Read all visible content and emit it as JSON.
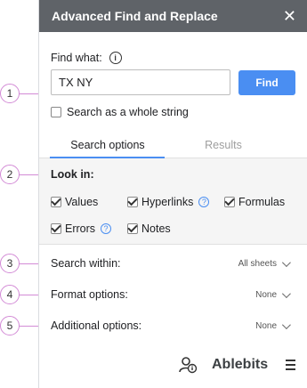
{
  "callouts": [
    "1",
    "2",
    "3",
    "4",
    "5"
  ],
  "window": {
    "title": "Advanced Find and Replace"
  },
  "find": {
    "label": "Find what:",
    "value": "TX NY",
    "button": "Find",
    "whole_string_label": "Search as a whole string",
    "whole_string_checked": false
  },
  "tabs": [
    {
      "label": "Search options",
      "active": true
    },
    {
      "label": "Results",
      "active": false
    }
  ],
  "look_in": {
    "title": "Look in:",
    "options": [
      {
        "label": "Values",
        "checked": true
      },
      {
        "label": "Hyperlinks",
        "checked": true
      },
      {
        "label": "Formulas",
        "checked": true
      },
      {
        "label": "Errors",
        "checked": true
      },
      {
        "label": "Notes",
        "checked": true
      }
    ]
  },
  "search_within": {
    "label": "Search within:",
    "value": "All sheets"
  },
  "format_options": {
    "label": "Format options:",
    "value": "None"
  },
  "additional_options": {
    "label": "Additional options:",
    "value": "None"
  },
  "footer": {
    "brand": "Ablebits"
  },
  "icons": [
    "close-icon",
    "info-icon",
    "help-icon",
    "chevron-down-icon",
    "person-info-icon",
    "menu-icon"
  ],
  "colors": {
    "titlebar": "#5f6368",
    "accent": "#4a8ef2",
    "callout": "#d38bd6"
  }
}
